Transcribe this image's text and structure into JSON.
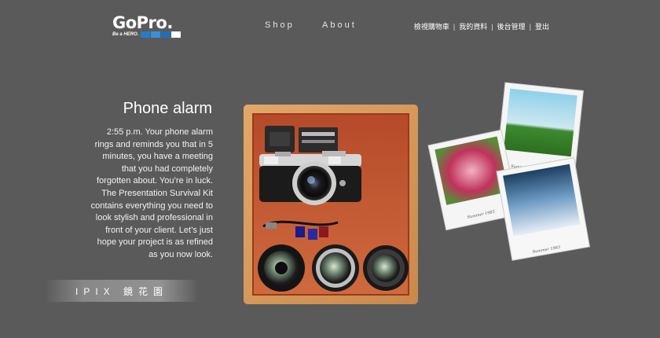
{
  "header": {
    "logo": {
      "wordmark": "GoPro.",
      "tagline": "Be a HERO.",
      "blocks": [
        "#2a7bc7",
        "#3a8fd6",
        "#1f6fb8",
        "#ffffff"
      ]
    },
    "nav": [
      {
        "label": "Shop"
      },
      {
        "label": "About"
      }
    ],
    "top_links": [
      {
        "label": "檢視購物車"
      },
      {
        "label": "我的資料"
      },
      {
        "label": "後台管理"
      },
      {
        "label": "登出"
      }
    ],
    "separator": "|"
  },
  "main": {
    "title": "Phone alarm",
    "description": "2:55 p.m. Your phone alarm rings and reminds you that in 5 minutes, you have a meeting that you had completely forgotten about. You’re in luck. The Presentation Survival Kit contains everything you need to look stylish and professional in front of your client. Let’s just hope your project is as refined as you now look.",
    "brand_button": "IPIX 鏡花園"
  },
  "polaroids": [
    {
      "caption": "Summer 1983"
    },
    {
      "caption": "Summer 1983"
    },
    {
      "caption": "Summer 1983"
    }
  ],
  "colors": {
    "background": "#5a5a5a",
    "box_wood": "#d79a5c",
    "box_inner": "#c55b36"
  }
}
